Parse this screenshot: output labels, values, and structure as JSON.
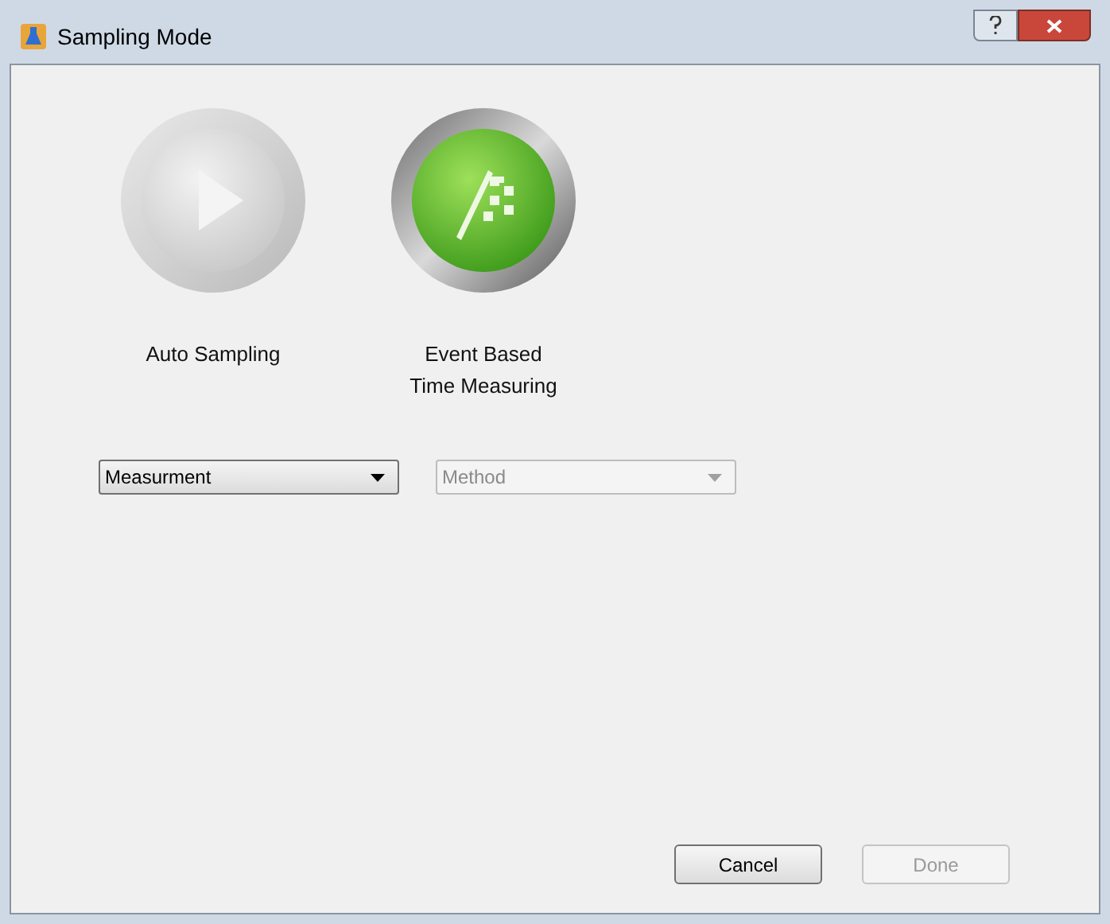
{
  "window": {
    "title": "Sampling Mode"
  },
  "modes": [
    {
      "kind": "play",
      "label": "Auto Sampling",
      "selected": false
    },
    {
      "kind": "flag",
      "label": "Event Based\nTime Measuring",
      "selected": true
    }
  ],
  "dropdowns": [
    {
      "value": "Measurment",
      "disabled": false
    },
    {
      "placeholder": "Method",
      "disabled": true
    }
  ],
  "buttons": [
    {
      "label": "Cancel",
      "disabled": false
    },
    {
      "label": "Done",
      "disabled": true
    }
  ]
}
